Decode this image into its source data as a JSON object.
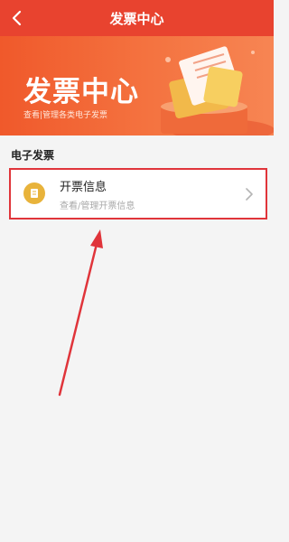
{
  "nav": {
    "title": "发票中心"
  },
  "banner": {
    "title": "发票中心",
    "subtitle": "查看|管理各类电子发票"
  },
  "section": {
    "title": "电子发票"
  },
  "invoice_info": {
    "title": "开票信息",
    "subtitle": "查看/管理开票信息"
  },
  "colors": {
    "brand_red": "#e8432f",
    "banner_orange": "#f47340",
    "icon_gold": "#e8b33b",
    "highlight_red": "#e0343a"
  },
  "icons": {
    "back": "chevron-left-icon",
    "card": "invoice-icon",
    "row_action": "chevron-right-icon"
  }
}
